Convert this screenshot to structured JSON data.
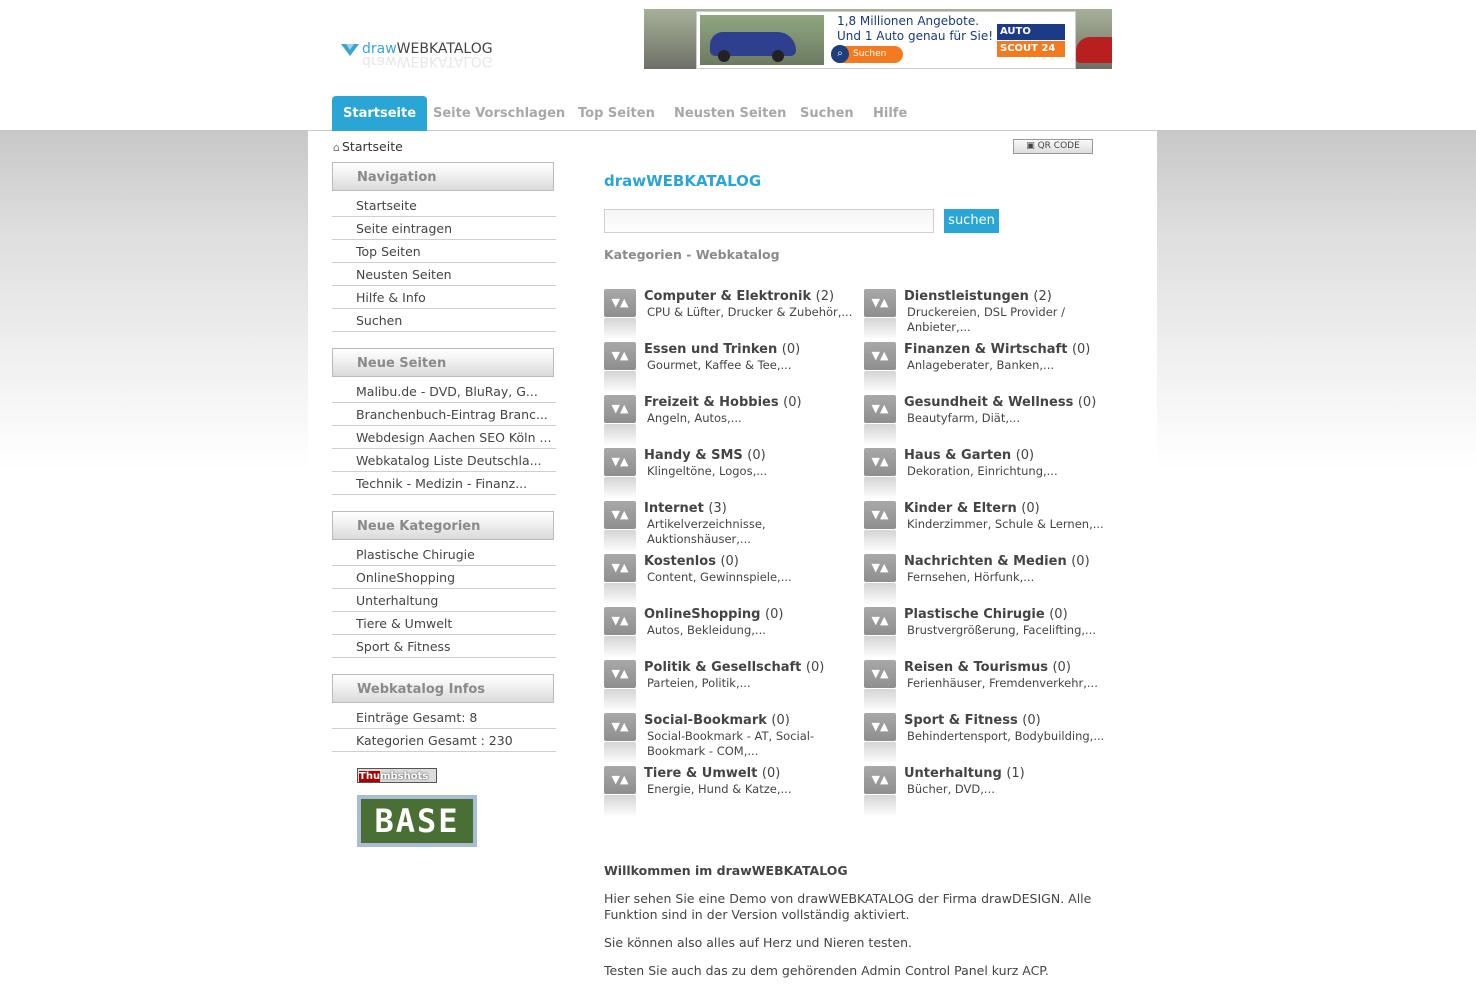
{
  "logo": {
    "text_draw": "draw",
    "text_brand": "WEBKATALOG"
  },
  "banner": {
    "line1": "1,8 Millionen Angebote.",
    "line2": "Und 1 Auto genau für Sie!",
    "search_label": "Suchen",
    "brand_top": "AUTO",
    "brand_bottom": "SCOUT 24"
  },
  "tabs": [
    {
      "label": "Startseite",
      "active": true
    },
    {
      "label": "Seite Vorschlagen"
    },
    {
      "label": "Top Seiten"
    },
    {
      "label": "Neusten Seiten"
    },
    {
      "label": "Suchen"
    },
    {
      "label": "Hilfe"
    }
  ],
  "breadcrumb": "Startseite",
  "qr_label": "QR CODE",
  "sidebar": {
    "navigation": {
      "title": "Navigation",
      "items": [
        "Startseite",
        "Seite eintragen",
        "Top Seiten",
        "Neusten Seiten",
        "Hilfe & Info",
        "Suchen"
      ]
    },
    "neue_seiten": {
      "title": "Neue Seiten",
      "items": [
        "Malibu.de - DVD, BluRay, G...",
        "Branchenbuch-Eintrag Branc...",
        "Webdesign Aachen SEO Köln ...",
        "Webkatalog Liste Deutschla...",
        "Technik - Medizin - Finanz..."
      ]
    },
    "neue_kategorien": {
      "title": "Neue Kategorien",
      "items": [
        "Plastische Chirugie",
        "OnlineShopping",
        "Unterhaltung",
        "Tiere & Umwelt",
        "Sport & Fitness"
      ]
    },
    "infos": {
      "title": "Webkatalog Infos",
      "items": [
        "Einträge Gesamt: 8",
        "Kategorien Gesamt : 230"
      ]
    },
    "thumbshots_a": "Thu",
    "thumbshots_b": "mbshots",
    "base_label": "BASE"
  },
  "main": {
    "title": "drawWEBKATALOG",
    "search_button": "suchen",
    "categories_heading": "Kategorien - Webkatalog",
    "icon_glyph": "▼▲",
    "categories": [
      {
        "name": "Computer & Elektronik",
        "count": "(2)",
        "sub": "CPU & Lüfter, Drucker & Zubehör,..."
      },
      {
        "name": "Dienstleistungen",
        "count": "(2)",
        "sub": "Druckereien, DSL Provider / Anbieter,..."
      },
      {
        "name": "Essen und Trinken",
        "count": "(0)",
        "sub": "Gourmet, Kaffee & Tee,..."
      },
      {
        "name": "Finanzen & Wirtschaft",
        "count": "(0)",
        "sub": "Anlageberater, Banken,..."
      },
      {
        "name": "Freizeit & Hobbies",
        "count": "(0)",
        "sub": "Angeln, Autos,..."
      },
      {
        "name": "Gesundheit & Wellness",
        "count": "(0)",
        "sub": "Beautyfarm, Diät,..."
      },
      {
        "name": "Handy & SMS",
        "count": "(0)",
        "sub": "Klingeltöne, Logos,..."
      },
      {
        "name": "Haus & Garten",
        "count": "(0)",
        "sub": "Dekoration, Einrichtung,..."
      },
      {
        "name": "Internet",
        "count": "(3)",
        "sub": "Artikelverzeichnisse, Auktionshäuser,..."
      },
      {
        "name": "Kinder & Eltern",
        "count": "(0)",
        "sub": "Kinderzimmer, Schule & Lernen,..."
      },
      {
        "name": "Kostenlos",
        "count": "(0)",
        "sub": "Content, Gewinnspiele,..."
      },
      {
        "name": "Nachrichten & Medien",
        "count": "(0)",
        "sub": "Fernsehen, Hörfunk,..."
      },
      {
        "name": "OnlineShopping",
        "count": "(0)",
        "sub": "Autos, Bekleidung,..."
      },
      {
        "name": "Plastische Chirugie",
        "count": "(0)",
        "sub": "Brustvergrößerung, Facelifting,..."
      },
      {
        "name": "Politik & Gesellschaft",
        "count": "(0)",
        "sub": "Parteien, Politik,..."
      },
      {
        "name": "Reisen & Tourismus",
        "count": "(0)",
        "sub": "Ferienhäuser, Fremdenverkehr,..."
      },
      {
        "name": "Social-Bookmark",
        "count": "(0)",
        "sub": "Social-Bookmark - AT, Social-Bookmark - COM,..."
      },
      {
        "name": "Sport & Fitness",
        "count": "(0)",
        "sub": "Behindertensport, Bodybuilding,..."
      },
      {
        "name": "Tiere & Umwelt",
        "count": "(0)",
        "sub": "Energie, Hund & Katze,..."
      },
      {
        "name": "Unterhaltung",
        "count": "(1)",
        "sub": "Bücher, DVD,..."
      }
    ],
    "welcome_title": "Willkommen im drawWEBKATALOG",
    "paragraphs": [
      "Hier sehen Sie eine Demo von drawWEBKATALOG der Firma drawDESIGN. Alle Funktion sind in der Version vollständig aktiviert.",
      "Sie können also alles auf Herz und Nieren testen.",
      "Testen Sie auch das zu dem gehörenden Admin Control Panel kurz ACP."
    ]
  }
}
